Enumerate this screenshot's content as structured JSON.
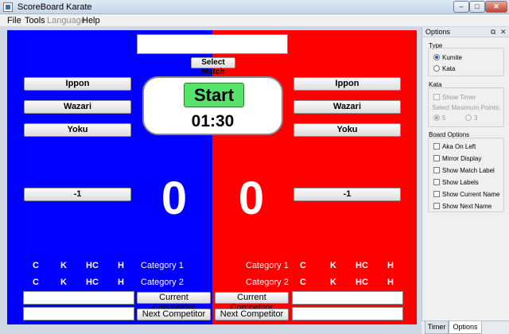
{
  "window": {
    "title": "ScoreBoard Karate",
    "min": "–",
    "max": "□",
    "close": "✕"
  },
  "menu": [
    {
      "label": "File",
      "enabled": true
    },
    {
      "label": "Tools",
      "enabled": true
    },
    {
      "label": "Language",
      "enabled": false
    },
    {
      "label": "Help",
      "enabled": true
    }
  ],
  "board": {
    "select_match": "Select Match",
    "start": "Start",
    "timer": "01:30",
    "blue": {
      "ippon": "Ippon",
      "wazari": "Wazari",
      "yoku": "Yoku",
      "minus": "-1",
      "score": "0",
      "cat_letters": [
        "C",
        "K",
        "HC",
        "H"
      ],
      "category1": "Category 1",
      "category2": "Category 2",
      "current_competitor": "Current Competitor",
      "next_competitor": "Next Competitor"
    },
    "red": {
      "ippon": "Ippon",
      "wazari": "Wazari",
      "yoku": "Yoku",
      "minus": "-1",
      "score": "0",
      "cat_letters": [
        "C",
        "K",
        "HC",
        "H"
      ],
      "category1": "Category 1",
      "category2": "Category 2",
      "current_competitor": "Current Competitor",
      "next_competitor": "Next Competitor"
    },
    "colors": {
      "blue": "#0000ff",
      "red": "#ff0000",
      "start": "#58e36b"
    }
  },
  "options": {
    "title": "Options",
    "type_group": "Type",
    "type_options": [
      {
        "label": "Kumite",
        "selected": true
      },
      {
        "label": "Kata",
        "selected": false
      }
    ],
    "kata_group": "Kata",
    "show_timer": "Show Timer",
    "select_max_points": "Select Maximum Points:",
    "points": [
      {
        "label": "5",
        "selected": true
      },
      {
        "label": "3",
        "selected": false
      }
    ],
    "board_group": "Board Options",
    "board_options": [
      "Aka On Left",
      "Mirror Display",
      "Show Match Label",
      "Show Labels",
      "Show Current Name",
      "Show Next Name"
    ]
  },
  "tabs": [
    {
      "label": "Timer",
      "active": false
    },
    {
      "label": "Options",
      "active": true
    }
  ]
}
